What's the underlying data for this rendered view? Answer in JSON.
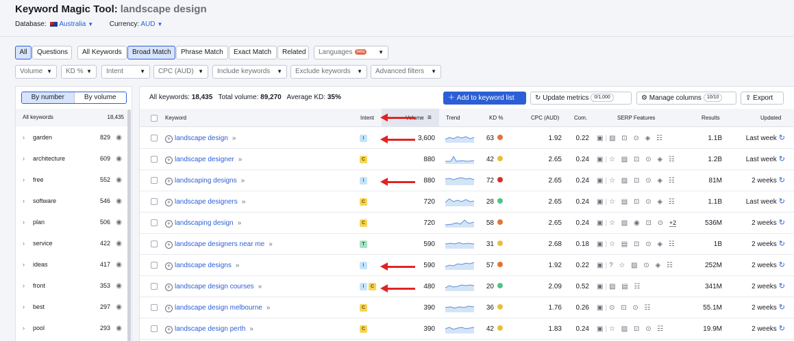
{
  "header": {
    "title": "Keyword Magic Tool:",
    "query": "landscape design",
    "database_label": "Database:",
    "database_value": "Australia",
    "currency_label": "Currency:",
    "currency_value": "AUD"
  },
  "filters": {
    "match_tabs": [
      "All",
      "Questions",
      "All Keywords",
      "Broad Match",
      "Phrase Match",
      "Exact Match",
      "Related"
    ],
    "languages": "Languages",
    "beta": "beta",
    "dropdowns": [
      "Volume",
      "KD %",
      "Intent",
      "CPC (AUD)",
      "Include keywords",
      "Exclude keywords",
      "Advanced filters"
    ]
  },
  "sidebar": {
    "toggle_by_number": "By number",
    "toggle_by_volume": "By volume",
    "all_label": "All keywords",
    "all_count": "18,435",
    "groups": [
      {
        "label": "garden",
        "count": "829"
      },
      {
        "label": "architecture",
        "count": "609"
      },
      {
        "label": "free",
        "count": "552"
      },
      {
        "label": "software",
        "count": "546"
      },
      {
        "label": "plan",
        "count": "506"
      },
      {
        "label": "service",
        "count": "422"
      },
      {
        "label": "ideas",
        "count": "417"
      },
      {
        "label": "front",
        "count": "353"
      },
      {
        "label": "best",
        "count": "297"
      },
      {
        "label": "pool",
        "count": "293"
      }
    ]
  },
  "summary": {
    "all_keywords_label": "All keywords:",
    "all_keywords_value": "18,435",
    "total_volume_label": "Total volume:",
    "total_volume_value": "89,270",
    "avg_kd_label": "Average KD:",
    "avg_kd_value": "35%"
  },
  "toolbar": {
    "add_to_list": "Add to keyword list",
    "update_metrics": "Update metrics",
    "update_count": "0/1,000",
    "manage_columns": "Manage columns",
    "columns_count": "10/10",
    "export": "Export"
  },
  "columns": {
    "keyword": "Keyword",
    "intent": "Intent",
    "volume": "Volume",
    "trend": "Trend",
    "kd": "KD %",
    "cpc": "CPC (AUD)",
    "com": "Com.",
    "serp": "SERP Features",
    "results": "Results",
    "updated": "Updated"
  },
  "rows": [
    {
      "keyword": "landscape design",
      "intent": [
        "I"
      ],
      "volume": "3,600",
      "kd": "63",
      "kd_color": "#e2743a",
      "cpc": "1.92",
      "com": "0.22",
      "serp": "▣|▨ ⊡ ⊙ ◈ ☷",
      "results": "1.1B",
      "updated": "Last week"
    },
    {
      "keyword": "landscape designer",
      "intent": [
        "C"
      ],
      "volume": "880",
      "kd": "42",
      "kd_color": "#e8bf3c",
      "cpc": "2.65",
      "com": "0.24",
      "serp": "▣|☆ ▨ ⊡ ⊙ ◈ ☷",
      "results": "1.2B",
      "updated": "Last week"
    },
    {
      "keyword": "landscaping designs",
      "intent": [
        "I"
      ],
      "volume": "880",
      "kd": "72",
      "kd_color": "#d92f2f",
      "cpc": "2.65",
      "com": "0.24",
      "serp": "▣|☆ ▨ ⊡ ⊙ ◈ ☷",
      "results": "81M",
      "updated": "2 weeks"
    },
    {
      "keyword": "landscape designers",
      "intent": [
        "C"
      ],
      "volume": "720",
      "kd": "28",
      "kd_color": "#4fc389",
      "cpc": "2.65",
      "com": "0.24",
      "serp": "▣|☆ ▤ ⊡ ⊙ ◈ ☷",
      "results": "1.1B",
      "updated": "Last week"
    },
    {
      "keyword": "landscaping design",
      "intent": [
        "C"
      ],
      "volume": "720",
      "kd": "58",
      "kd_color": "#e2743a",
      "cpc": "2.65",
      "com": "0.24",
      "serp": "▣|☆ ▨ ◉ ⊡ ⊙",
      "serp_more": "+2",
      "results": "536M",
      "updated": "2 weeks"
    },
    {
      "keyword": "landscape designers near me",
      "intent": [
        "T"
      ],
      "volume": "590",
      "kd": "31",
      "kd_color": "#e8bf3c",
      "cpc": "2.68",
      "com": "0.18",
      "serp": "▣|☆ ▤ ⊡ ⊙ ◈ ☷",
      "results": "1B",
      "updated": "2 weeks"
    },
    {
      "keyword": "landscape designs",
      "intent": [
        "I"
      ],
      "volume": "590",
      "kd": "57",
      "kd_color": "#e2743a",
      "cpc": "1.92",
      "com": "0.22",
      "serp": "▣|? ☆ ▨ ⊙ ◈ ☷",
      "results": "252M",
      "updated": "2 weeks"
    },
    {
      "keyword": "landscape design courses",
      "intent": [
        "I",
        "C"
      ],
      "volume": "480",
      "kd": "20",
      "kd_color": "#4fc389",
      "cpc": "2.09",
      "com": "0.52",
      "serp": "▣|▨ ▤ ☷",
      "results": "341M",
      "updated": "2 weeks"
    },
    {
      "keyword": "landscape design melbourne",
      "intent": [
        "C"
      ],
      "volume": "390",
      "kd": "36",
      "kd_color": "#e8bf3c",
      "cpc": "1.76",
      "com": "0.26",
      "serp": "▣|⊙ ⊡ ⊙ ☷",
      "results": "55.1M",
      "updated": "2 weeks"
    },
    {
      "keyword": "landscape design perth",
      "intent": [
        "C"
      ],
      "volume": "390",
      "kd": "42",
      "kd_color": "#e8bf3c",
      "cpc": "1.83",
      "com": "0.24",
      "serp": "▣|☆ ▨ ⊡ ⊙ ☷",
      "results": "19.9M",
      "updated": "2 weeks"
    }
  ]
}
